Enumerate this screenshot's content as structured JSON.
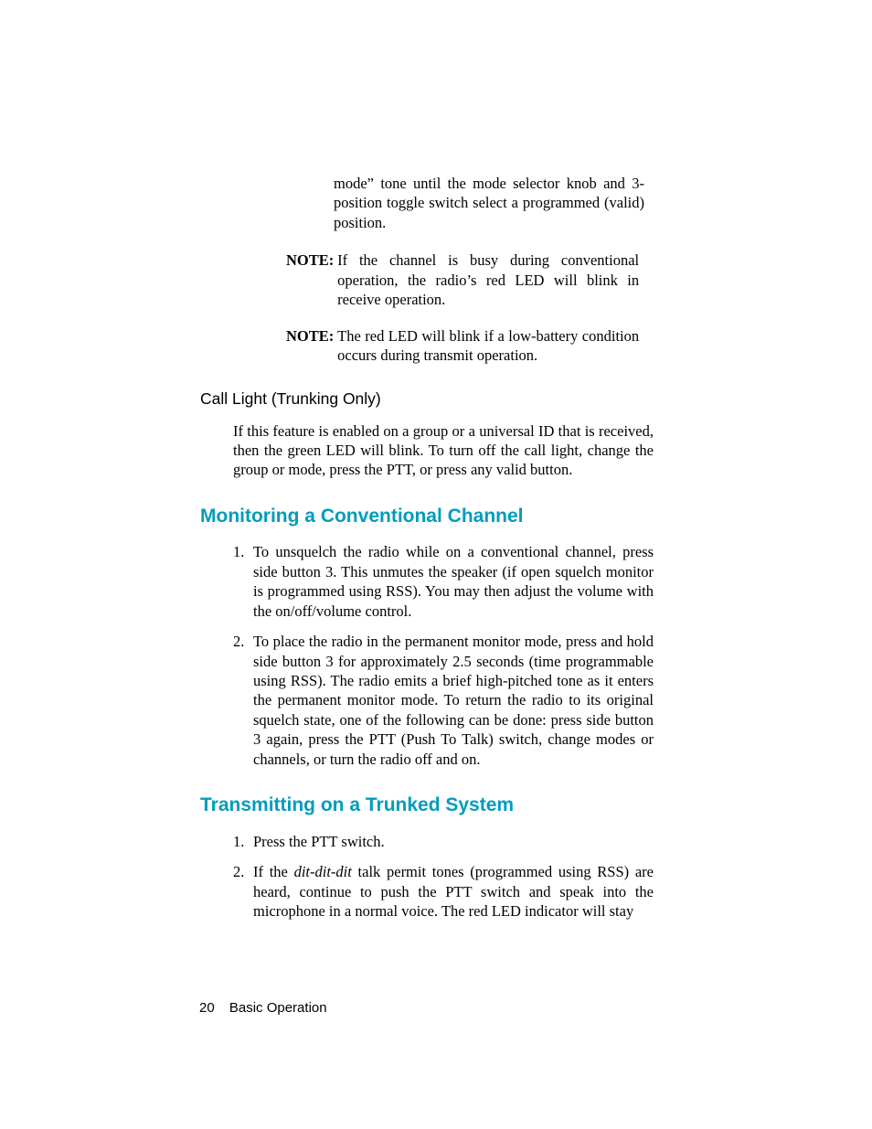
{
  "continuation": "mode” tone until the mode selector knob and 3-position toggle switch select a programmed (valid) position.",
  "notes": [
    {
      "label": "NOTE:",
      "text": "If the channel is busy during conventional operation, the radio’s red LED will blink in receive operation."
    },
    {
      "label": "NOTE:",
      "text": "The red LED will blink if a low-battery condition occurs during transmit operation."
    }
  ],
  "subhead_call_light": "Call Light (Trunking Only)",
  "call_light_para": "If this feature is enabled on a group or a universal ID that is received, then the green LED will blink. To turn off the call light, change the group or mode, press the PTT, or press any valid button.",
  "section_monitoring": "Monitoring a Conventional Channel",
  "monitor_list": [
    "To unsquelch the radio while on a conventional channel, press side button 3. This unmutes the speaker (if open squelch monitor is programmed using RSS). You may then adjust the volume with the on/off/volume control.",
    "To place the radio in the permanent monitor mode, press and hold side button 3 for approximately 2.5 seconds (time programmable using RSS). The radio emits a brief high-pitched tone as it enters the permanent monitor mode. To return the radio to its original squelch state, one of the following can be done: press side button 3 again, press the PTT (Push To Talk) switch, change modes or channels, or turn the radio off and on."
  ],
  "section_transmitting": "Transmitting on a Trunked System",
  "trans_list": {
    "item1": "Press the PTT switch.",
    "item2_pre": "If the ",
    "item2_em": "dit-dit-dit",
    "item2_post": " talk permit tones (programmed using RSS) are heard, continue to push the PTT switch and speak into the microphone in a normal voice. The red LED indicator will stay"
  },
  "footer": {
    "page": "20",
    "section": "Basic Operation"
  },
  "nums": {
    "one": "1.",
    "two": "2."
  }
}
